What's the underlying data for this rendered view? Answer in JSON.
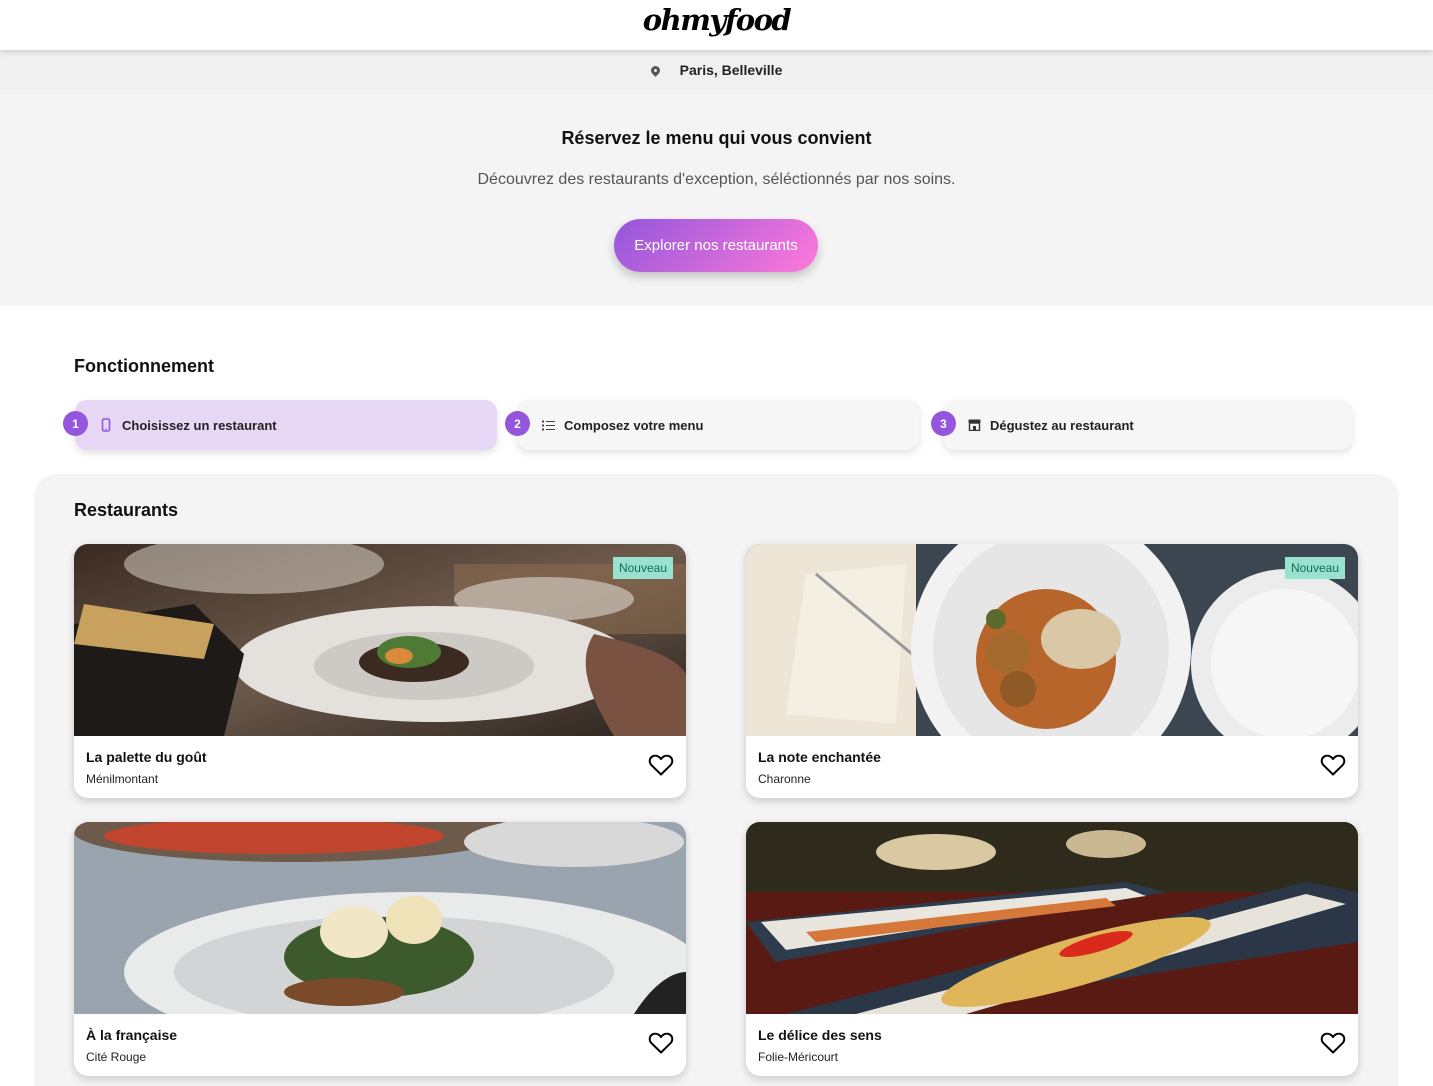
{
  "header": {
    "logo": "ohmyfood"
  },
  "location": {
    "icon": "map-pin-icon",
    "label": "Paris, Belleville"
  },
  "hero": {
    "title": "Réservez le menu qui vous convient",
    "subtitle": "Découvrez des restaurants d'exception, séléctionnés par nos soins.",
    "button": "Explorer nos restaurants",
    "button_colors": [
      "#9356dc",
      "#ff79da"
    ]
  },
  "how": {
    "title": "Fonctionnement",
    "steps": [
      {
        "num": "1",
        "icon": "mobile-phone-icon",
        "label": "Choisissez un restaurant"
      },
      {
        "num": "2",
        "icon": "list-icon",
        "label": "Composez votre menu"
      },
      {
        "num": "3",
        "icon": "store-icon",
        "label": "Dégustez au restaurant"
      }
    ]
  },
  "restaurants": {
    "title": "Restaurants",
    "items": [
      {
        "name": "La palette du goût",
        "area": "Ménilmontant",
        "badge": "Nouveau",
        "favorite_icon": "heart-outline-icon"
      },
      {
        "name": "La note enchantée",
        "area": "Charonne",
        "badge": "Nouveau",
        "favorite_icon": "heart-outline-icon"
      },
      {
        "name": "À la française",
        "area": "Cité Rouge",
        "favorite_icon": "heart-outline-icon"
      },
      {
        "name": "Le délice des sens",
        "area": "Folie-Méricourt",
        "favorite_icon": "heart-outline-icon"
      }
    ]
  },
  "colors": {
    "accent": "#9356dc",
    "badge_bg": "#99e2d0",
    "badge_text": "#126a55",
    "active_step_bg": "#e6d7f5"
  }
}
